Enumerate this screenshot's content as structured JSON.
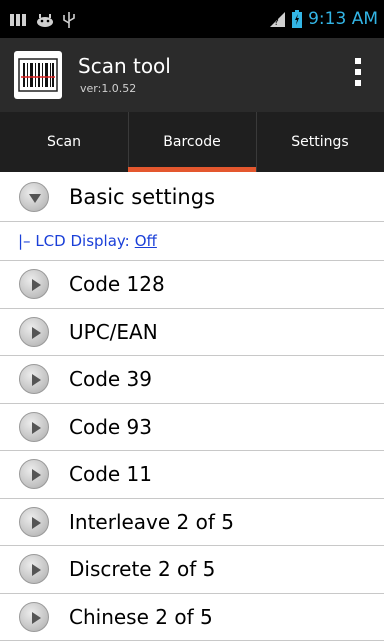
{
  "status_bar": {
    "time": "9:13 AM",
    "left_icons": [
      "notification-icon",
      "android-icon",
      "usb-icon"
    ],
    "right_icons": [
      "signal-icon",
      "battery-icon"
    ],
    "accent": "#33b5e5"
  },
  "action_bar": {
    "title": "Scan tool",
    "version": "ver:1.0.52",
    "app_icon": "barcode-icon",
    "menu_icon": "overflow-menu-icon"
  },
  "tabs": [
    {
      "label": "Scan",
      "selected": false
    },
    {
      "label": "Barcode",
      "selected": true
    },
    {
      "label": "Settings",
      "selected": false
    }
  ],
  "tab_indicator_color": "#e4572e",
  "group": {
    "label": "Basic settings",
    "icon": "expand-down-icon",
    "expanded": true
  },
  "lcd_display": {
    "label": "|– LCD Display:",
    "value": "Off",
    "color": "#1a3fd8"
  },
  "items": [
    {
      "label": "Code 128",
      "icon": "expand-right-icon"
    },
    {
      "label": "UPC/EAN",
      "icon": "expand-right-icon"
    },
    {
      "label": "Code 39",
      "icon": "expand-right-icon"
    },
    {
      "label": "Code 93",
      "icon": "expand-right-icon"
    },
    {
      "label": "Code 11",
      "icon": "expand-right-icon"
    },
    {
      "label": "Interleave 2 of 5",
      "icon": "expand-right-icon"
    },
    {
      "label": "Discrete 2 of 5",
      "icon": "expand-right-icon"
    },
    {
      "label": "Chinese 2 of 5",
      "icon": "expand-right-icon"
    }
  ]
}
